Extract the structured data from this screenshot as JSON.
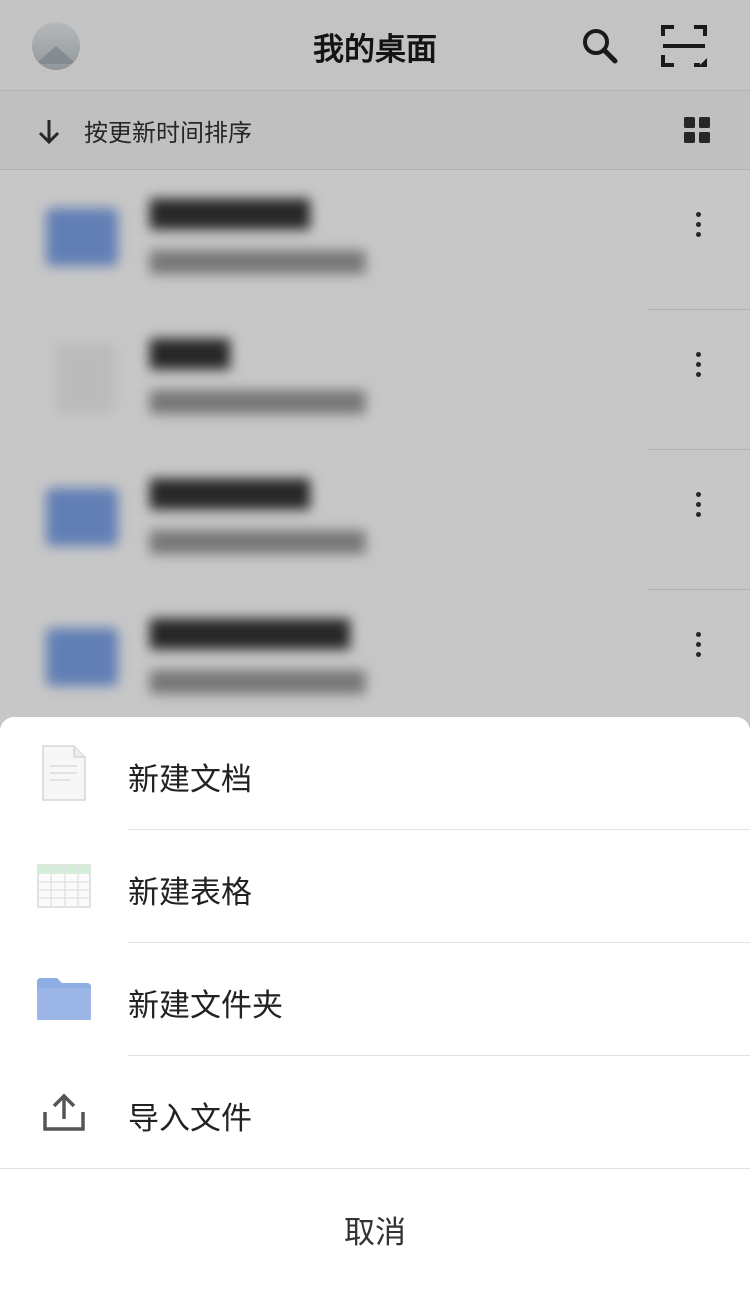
{
  "header": {
    "title": "我的桌面"
  },
  "sort": {
    "label": "按更新时间排序"
  },
  "icons": {
    "avatar": "avatar-image",
    "search": "search-icon",
    "scan": "scan-icon",
    "sort": "arrow-down-icon",
    "layout": "grid-view-icon",
    "more": "more-vertical-icon"
  },
  "files": [
    {
      "type": "folder"
    },
    {
      "type": "document"
    },
    {
      "type": "folder"
    },
    {
      "type": "folder"
    }
  ],
  "sheet": {
    "items": [
      {
        "label": "新建文档",
        "icon": "document-icon"
      },
      {
        "label": "新建表格",
        "icon": "spreadsheet-icon"
      },
      {
        "label": "新建文件夹",
        "icon": "folder-icon"
      },
      {
        "label": "导入文件",
        "icon": "upload-icon"
      }
    ],
    "cancel_label": "取消"
  },
  "colors": {
    "folder": "#9bb6e6",
    "overlay": "rgba(0,0,0,0.22)"
  }
}
